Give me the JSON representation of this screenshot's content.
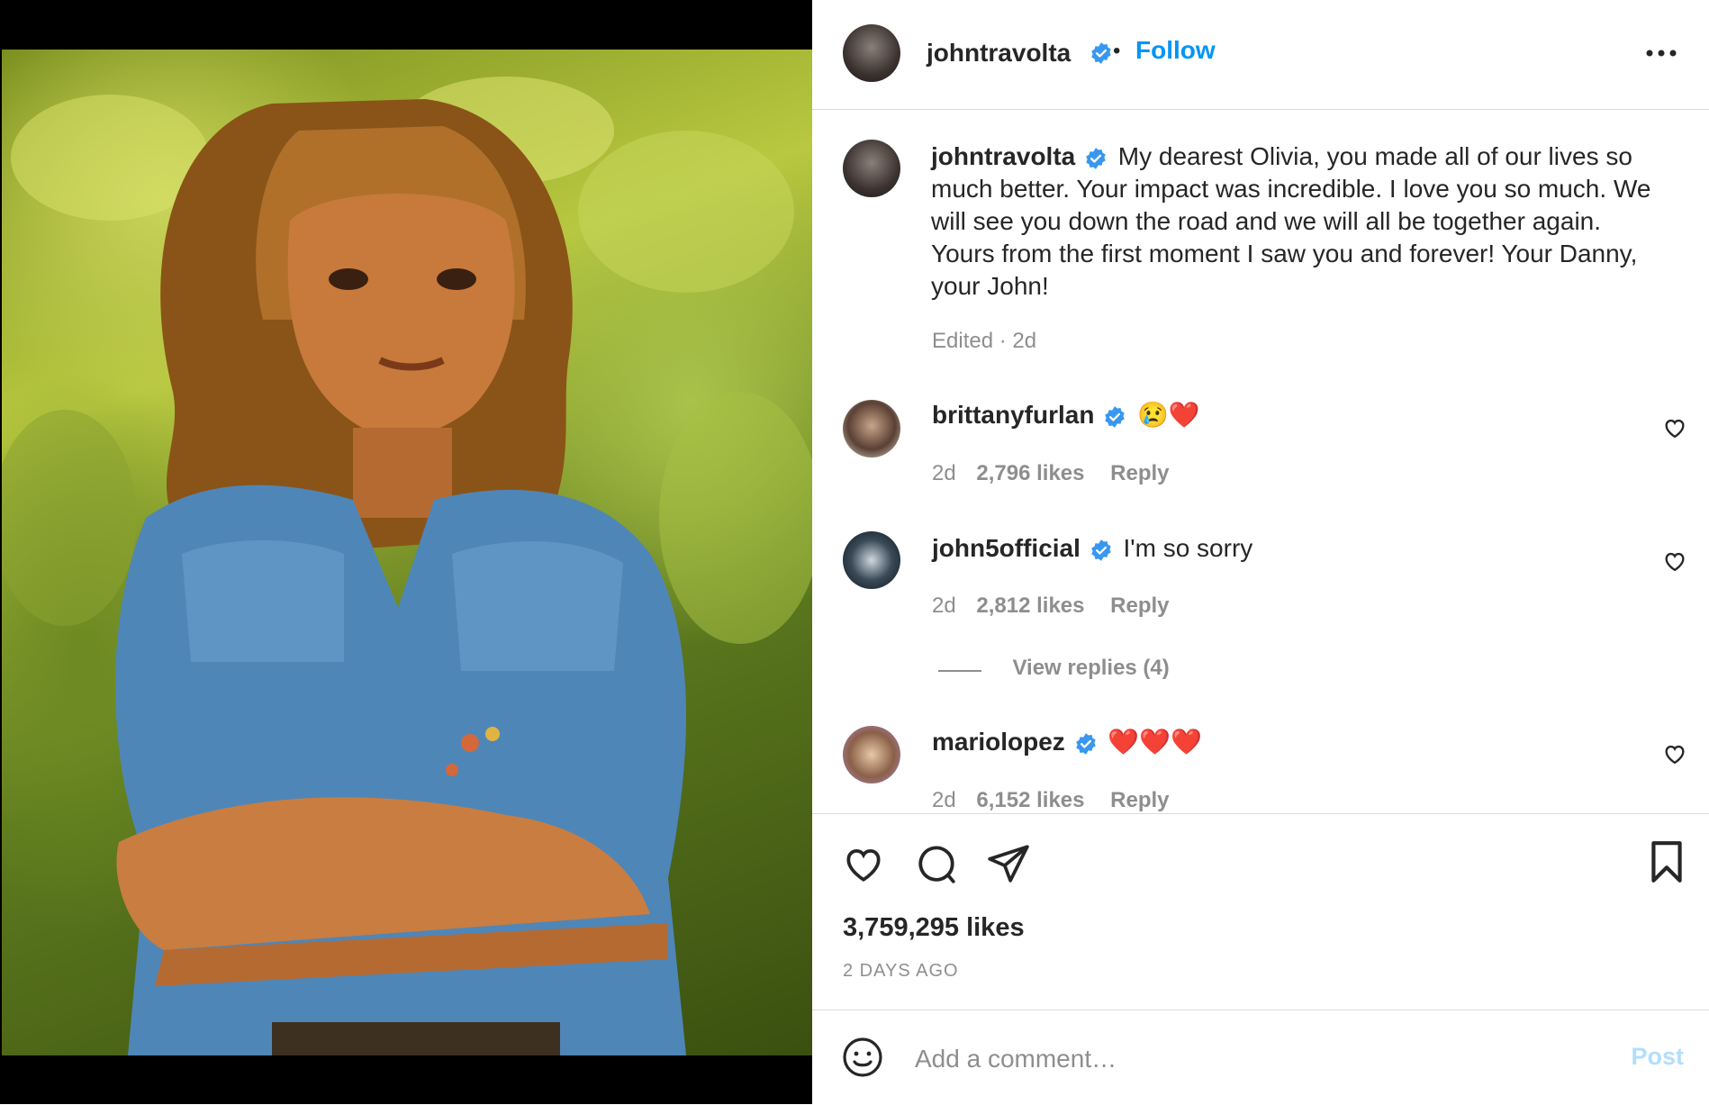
{
  "post": {
    "author": "johntravolta",
    "follow_label": "Follow",
    "separator": "•",
    "caption": "My dearest Olivia, you made all of our lives so much better. Your impact was incredible. I love you so much. We will see you down the road and we will all be together again. Yours from the first moment I saw you and forever! Your Danny, your John!",
    "caption_meta": "Edited · 2d",
    "likes": "3,759,295 likes",
    "time_ago": "2 DAYS AGO"
  },
  "comments": [
    {
      "user": "brittanyfurlan",
      "text": "😢❤️",
      "time": "2d",
      "likes": "2,796 likes",
      "reply": "Reply"
    },
    {
      "user": "john5official",
      "text": "I'm so sorry",
      "time": "2d",
      "likes": "2,812 likes",
      "reply": "Reply",
      "view_replies": "View replies (4)"
    },
    {
      "user": "mariolopez",
      "text": "❤️❤️❤️",
      "time": "2d",
      "likes": "6,152 likes",
      "reply": "Reply"
    }
  ],
  "add_comment": {
    "placeholder": "Add a comment…",
    "post_label": "Post"
  },
  "colors": {
    "accent": "#0095f6",
    "verified": "#3897f0",
    "muted": "#8e8e8e",
    "border": "#dbdbdb"
  },
  "icons": [
    "more-options-icon",
    "verified-icon",
    "heart-icon",
    "comment-icon",
    "share-icon",
    "bookmark-icon",
    "emoji-icon"
  ]
}
